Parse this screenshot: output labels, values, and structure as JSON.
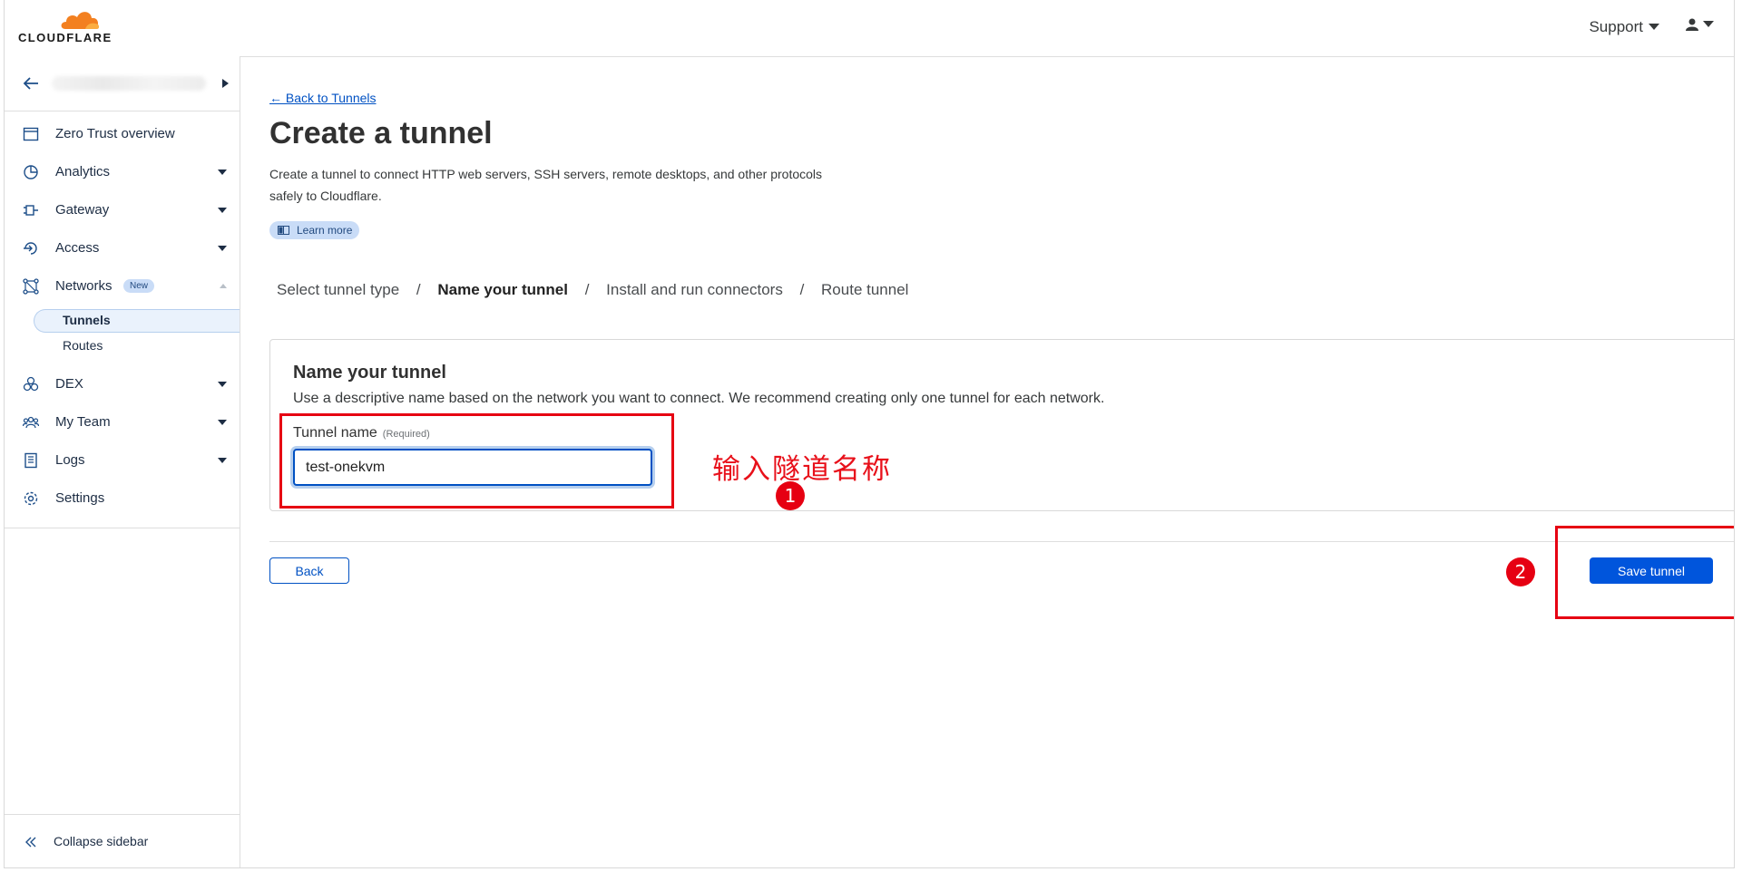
{
  "brand": {
    "wordmark": "CLOUDFLARE",
    "accent": "#f38020"
  },
  "topbar": {
    "support_label": "Support"
  },
  "sidebar": {
    "items": [
      {
        "label": "Zero Trust overview",
        "icon": "browser-window-icon",
        "expandable": false
      },
      {
        "label": "Analytics",
        "icon": "pie-chart-icon",
        "expandable": true
      },
      {
        "label": "Gateway",
        "icon": "gateway-icon",
        "expandable": true
      },
      {
        "label": "Access",
        "icon": "access-icon",
        "expandable": true
      },
      {
        "label": "Networks",
        "icon": "network-icon",
        "expandable": true,
        "badge": "New",
        "expanded": true
      },
      {
        "label": "DEX",
        "icon": "dex-icon",
        "expandable": true
      },
      {
        "label": "My Team",
        "icon": "team-icon",
        "expandable": true
      },
      {
        "label": "Logs",
        "icon": "logs-icon",
        "expandable": true
      },
      {
        "label": "Settings",
        "icon": "gear-icon",
        "expandable": false
      }
    ],
    "networks_sub": [
      {
        "label": "Tunnels",
        "active": true
      },
      {
        "label": "Routes",
        "active": false
      }
    ],
    "collapse_label": "Collapse sidebar"
  },
  "main": {
    "back_link": "← Back to Tunnels",
    "title": "Create a tunnel",
    "description": "Create a tunnel to connect HTTP web servers, SSH servers, remote desktops, and other protocols safely to Cloudflare.",
    "learn_more": "Learn more",
    "steps": [
      "Select tunnel type",
      "Name your tunnel",
      "Install and run connectors",
      "Route tunnel"
    ],
    "step_separator": "/",
    "current_step": "Name your tunnel",
    "card": {
      "title": "Name your tunnel",
      "description": "Use a descriptive name based on the network you want to connect. We recommend creating only one tunnel for each network.",
      "field_label": "Tunnel name",
      "field_required": "(Required)",
      "field_value": "test-onekvm"
    },
    "back_button": "Back",
    "save_button": "Save tunnel"
  },
  "annotations": {
    "note": "输入隧道名称",
    "marker_1": "1",
    "marker_2": "2",
    "color": "#e60012"
  }
}
